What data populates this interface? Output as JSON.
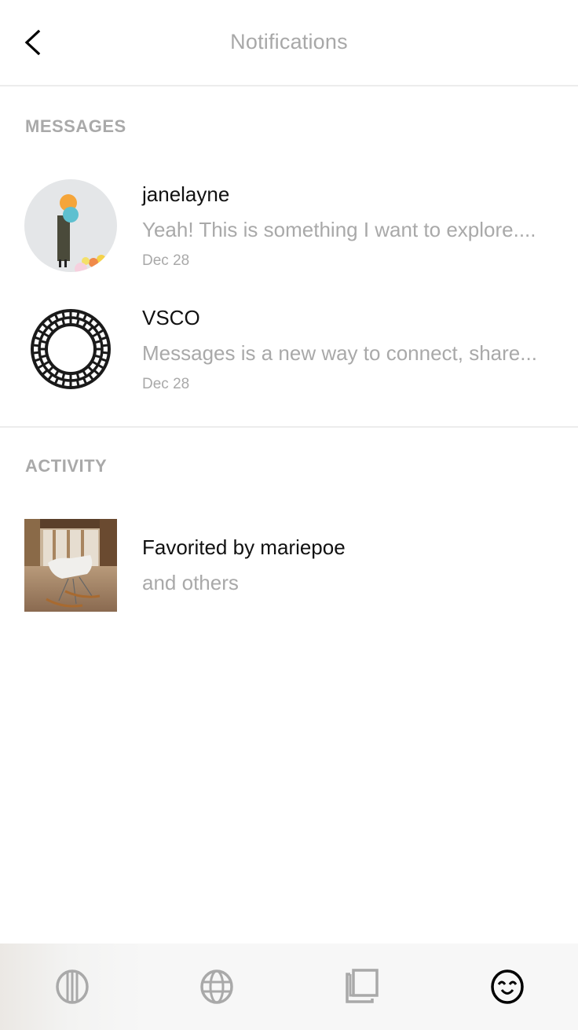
{
  "header": {
    "title": "Notifications",
    "back_icon": "chevron-left-icon"
  },
  "messages": {
    "label": "MESSAGES",
    "items": [
      {
        "name": "janelayne",
        "preview": "Yeah! This is something I want to explore....",
        "date": "Dec 28",
        "avatar": "photo-woman-with-balloons"
      },
      {
        "name": "VSCO",
        "preview": "Messages is a new way to connect, share...",
        "date": "Dec 28",
        "avatar": "vsco-logo"
      }
    ]
  },
  "activity": {
    "label": "ACTIVITY",
    "items": [
      {
        "title": "Favorited by mariepoe",
        "subtitle": "and others",
        "thumbnail": "photo-rocking-chair"
      }
    ]
  },
  "tabbar": {
    "items": [
      {
        "icon": "feed-icon",
        "active": false
      },
      {
        "icon": "globe-icon",
        "active": false
      },
      {
        "icon": "studio-icon",
        "active": false
      },
      {
        "icon": "smiley-face-icon",
        "active": true
      }
    ],
    "active_color": "#000000",
    "inactive_color": "#a9a9a9"
  }
}
